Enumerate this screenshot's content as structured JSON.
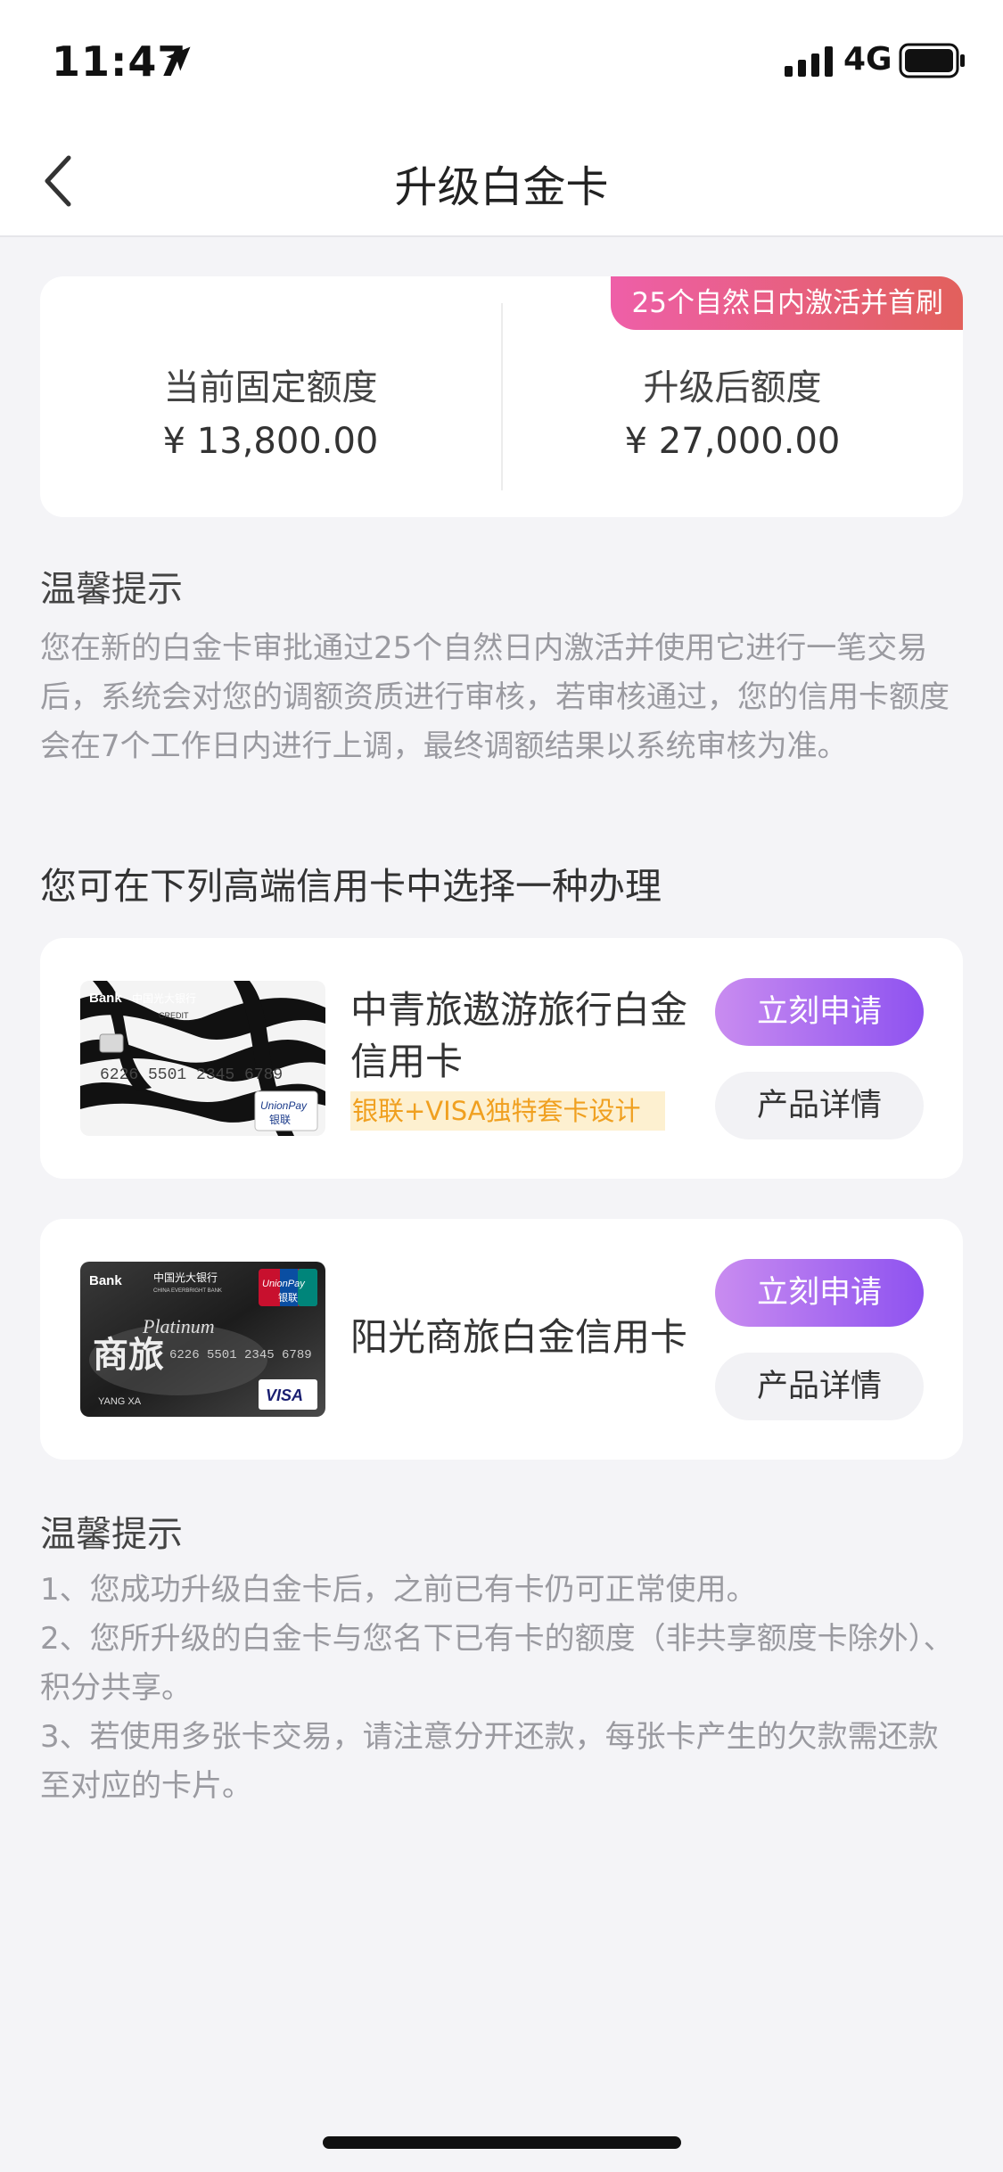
{
  "status_bar": {
    "time": "11:47",
    "network": "4G"
  },
  "nav": {
    "title": "升级白金卡"
  },
  "limits": {
    "badge": "25个自然日内激活并首刷",
    "current_label": "当前固定额度",
    "current_value": "¥ 13,800.00",
    "upgraded_label": "升级后额度",
    "upgraded_value": "¥ 27,000.00"
  },
  "tip1": {
    "title": "温馨提示",
    "body": "您在新的白金卡审批通过25个自然日内激活并使用它进行一笔交易后，系统会对您的调额资质进行审核，若审核通过，您的信用卡额度会在7个工作日内进行上调，最终调额结果以系统审核为准。"
  },
  "section_title": "您可在下列高端信用卡中选择一种办理",
  "products": [
    {
      "name": "中青旅遨游旅行白金信用卡",
      "tag": "银联+VISA独特套卡设计",
      "apply_label": "立刻申请",
      "detail_label": "产品详情"
    },
    {
      "name": "阳光商旅白金信用卡",
      "apply_label": "立刻申请",
      "detail_label": "产品详情"
    }
  ],
  "tip2": {
    "title": "温馨提示",
    "items": [
      "1、您成功升级白金卡后，之前已有卡仍可正常使用。",
      "2、您所升级的白金卡与您名下已有卡的额度（非共享额度卡除外）、积分共享。",
      "3、若使用多张卡交易，请注意分开还款，每张卡产生的欠款需还款至对应的卡片。"
    ]
  },
  "card_art": {
    "card1_texts": [
      "Bank",
      "中国光大银行",
      "CREDIT",
      "6226 5501 2345 6789",
      "UnionPay",
      "银联"
    ],
    "card2_texts": [
      "Bank",
      "中国光大银行",
      "CHINA EVERBRIGHT BANK",
      "Platinum",
      "商旅",
      "6226 5501 2345 6789",
      "YANG XA",
      "UnionPay",
      "银联",
      "VISA"
    ]
  },
  "colors": {
    "accent_start": "#c98cf0",
    "accent_end": "#8e52f0",
    "badge_start": "#ee5fa8",
    "badge_end": "#e2605c",
    "tag_text": "#f0a020"
  }
}
